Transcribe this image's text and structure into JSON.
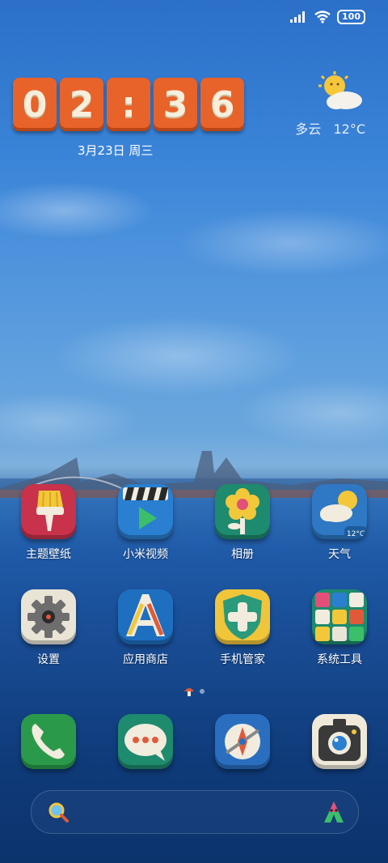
{
  "status_bar": {
    "signal_icon": "signal-icon",
    "wifi_icon": "wifi-icon",
    "battery_level": "100"
  },
  "clock": {
    "d1": "0",
    "d2": "2",
    "sep": ":",
    "d3": "3",
    "d4": "6"
  },
  "date": "3月23日 周三",
  "weather": {
    "icon": "partly-cloudy-sun-icon",
    "condition": "多云",
    "temperature": "12°C"
  },
  "apps_row1": [
    {
      "name": "主题壁纸"
    },
    {
      "name": "小米视频"
    },
    {
      "name": "相册"
    },
    {
      "name": "天气",
      "badge": "12°C"
    }
  ],
  "apps_row2": [
    {
      "name": "设置"
    },
    {
      "name": "应用商店"
    },
    {
      "name": "手机管家"
    },
    {
      "name": "系统工具"
    }
  ],
  "dock": [
    {
      "icon": "phone-icon"
    },
    {
      "icon": "messages-icon"
    },
    {
      "icon": "browser-icon"
    },
    {
      "icon": "camera-icon"
    }
  ],
  "search_bar": {
    "search_icon": "magnifier-icon",
    "assistant_icon": "assistant-icon"
  },
  "page_indicator": {
    "pages": 2,
    "current": 1
  }
}
